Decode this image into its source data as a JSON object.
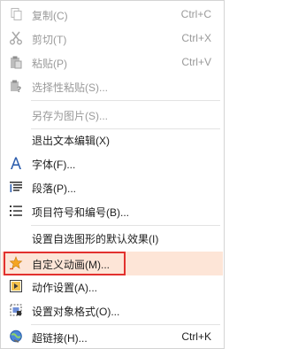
{
  "menu": {
    "copy": {
      "label": "复制(C)",
      "shortcut": "Ctrl+C",
      "icon": "copy-icon"
    },
    "cut": {
      "label": "剪切(T)",
      "shortcut": "Ctrl+X",
      "icon": "scissors-icon"
    },
    "paste": {
      "label": "粘贴(P)",
      "shortcut": "Ctrl+V",
      "icon": "clipboard-icon"
    },
    "paste_special": {
      "label": "选择性粘贴(S)...",
      "icon": "paste-special-icon"
    },
    "save_as_picture": {
      "label": "另存为图片(S)..."
    },
    "exit_text_edit": {
      "label": "退出文本编辑(X)"
    },
    "font": {
      "label": "字体(F)...",
      "icon": "font-icon"
    },
    "paragraph": {
      "label": "段落(P)...",
      "icon": "paragraph-icon"
    },
    "bullets_numbering": {
      "label": "项目符号和编号(B)...",
      "icon": "bullet-list-icon"
    },
    "set_default_effect": {
      "label": "设置自选图形的默认效果(I)"
    },
    "custom_animation": {
      "label": "自定义动画(M)...",
      "icon": "star-animation-icon"
    },
    "action_settings": {
      "label": "动作设置(A)...",
      "icon": "action-icon"
    },
    "format_object": {
      "label": "设置对象格式(O)...",
      "icon": "format-object-icon"
    },
    "hyperlink": {
      "label": "超链接(H)...",
      "shortcut": "Ctrl+K",
      "icon": "hyperlink-icon"
    }
  },
  "colors": {
    "highlight_bg": "#fde5d7",
    "highlight_border": "#e2312e",
    "disabled_text": "#9a9a9a"
  }
}
